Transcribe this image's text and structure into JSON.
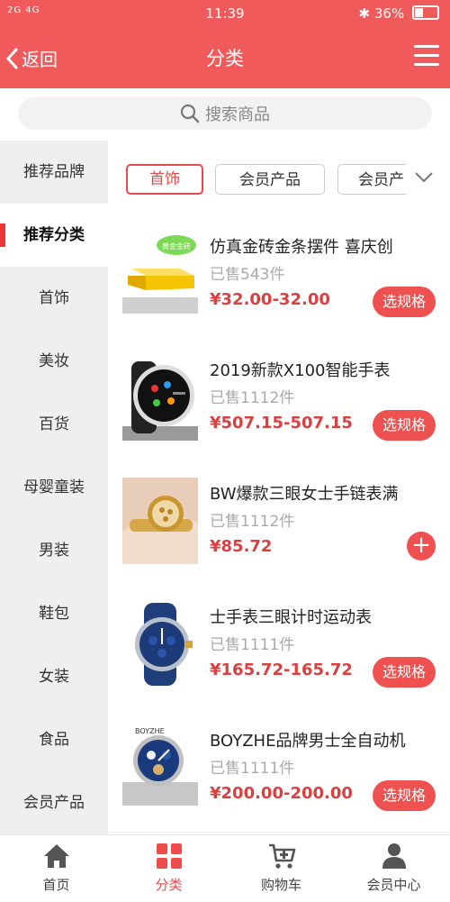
{
  "status_bar": {
    "signal": "2G 4G",
    "time": "11:39",
    "bluetooth": "bluetooth-icon",
    "battery": "36%"
  },
  "header": {
    "back_label": "返回",
    "title": "分类"
  },
  "search": {
    "placeholder": "搜索商品"
  },
  "sidebar": {
    "items": [
      "推荐品牌",
      "推荐分类",
      "首饰",
      "美妆",
      "百货",
      "母婴童装",
      "男装",
      "鞋包",
      "女装",
      "食品",
      "会员产品"
    ],
    "active_index": 1
  },
  "tabs": {
    "items": [
      "首饰",
      "会员产品",
      "会员产"
    ],
    "active_index": 0
  },
  "products": [
    {
      "name": "仿真金砖金条摆件 喜庆创",
      "sold": "已售543件",
      "price": "¥32.00-32.00",
      "action": "选规格",
      "image": "gold-bar-image",
      "img_badge": "黄金金砖"
    },
    {
      "name": "2019新款X100智能手表",
      "sold": "已售1112件",
      "price": "¥507.15-507.15",
      "action": "选规格",
      "image": "smartwatch-image"
    },
    {
      "name": "BW爆款三眼女士手链表满",
      "sold": "已售1112件",
      "price": "¥85.72",
      "action": "+",
      "image": "gold-bracelet-watch-image"
    },
    {
      "name": "士手表三眼计时运动表",
      "sold": "已售1111件",
      "price": "¥165.72-165.72",
      "action": "选规格",
      "image": "blue-sport-watch-image"
    },
    {
      "name": "BOYZHE品牌男士全自动机",
      "sold": "已售1111件",
      "price": "¥200.00-200.00",
      "action": "选规格",
      "image": "automatic-watch-image",
      "img_brand": "BOYZHE"
    }
  ],
  "tabbar": {
    "items": [
      {
        "label": "首页",
        "icon": "home-icon"
      },
      {
        "label": "分类",
        "icon": "category-grid-icon"
      },
      {
        "label": "购物车",
        "icon": "cart-icon"
      },
      {
        "label": "会员中心",
        "icon": "user-icon"
      }
    ],
    "active_index": 1
  },
  "colors": {
    "brand": "#f05a5a",
    "price": "#d94040",
    "active_tab": "#e84b4b"
  }
}
